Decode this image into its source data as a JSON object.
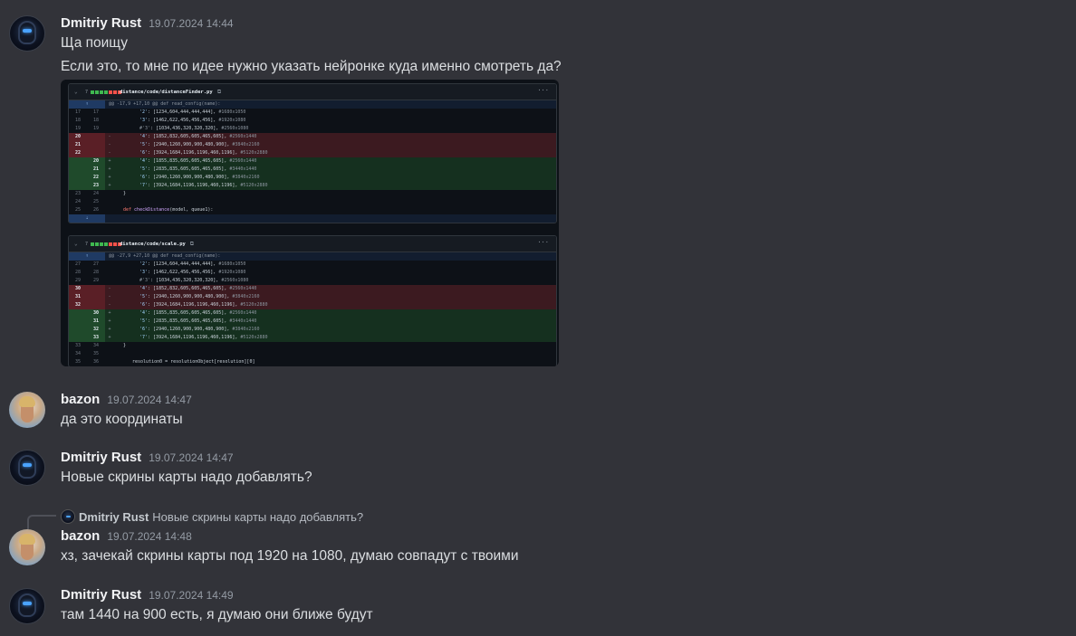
{
  "messages": [
    {
      "author": "Dmitriy Rust",
      "time": "19.07.2024 14:44",
      "lines": [
        "Ща поищу",
        "Если это, то мне по идее нужно указать нейронке куда именно смотреть да?"
      ]
    },
    {
      "author": "bazon",
      "time": "19.07.2024 14:47",
      "lines": [
        "да это координаты"
      ]
    },
    {
      "author": "Dmitriy Rust",
      "time": "19.07.2024 14:47",
      "lines": [
        "Новые скрины карты надо добавлять?"
      ]
    },
    {
      "reply_to": {
        "author": "Dmitriy Rust",
        "text": "Новые скрины карты надо добавлять?"
      },
      "author": "bazon",
      "time": "19.07.2024 14:48",
      "lines": [
        "хз, зачекай скрины карты под 1920 на 1080, думаю совпадут с твоими"
      ]
    },
    {
      "author": "Dmitriy Rust",
      "time": "19.07.2024 14:49",
      "lines": [
        "там 1440 на 900 есть, я думаю они ближе будут"
      ]
    }
  ],
  "code_image": {
    "files": [
      {
        "changes": "7",
        "path": "distance/code/distanceFinder.py",
        "hunk": "@@ -17,9 +17,10 @@ def read_config(name):",
        "rows": [
          {
            "t": "ctx",
            "o": "17",
            "n": "17",
            "s": "",
            "c": "'2': [1234,604,444,444,444], #1680x1050"
          },
          {
            "t": "ctx",
            "o": "18",
            "n": "18",
            "s": "",
            "c": "'3': [1462,622,456,456,456], #1920x1080"
          },
          {
            "t": "ctx",
            "o": "19",
            "n": "19",
            "s": "",
            "c": "#'3': [1034,436,320,320,320], #2560x1080"
          },
          {
            "t": "del",
            "o": "20",
            "n": "",
            "s": "-",
            "c": "'4': [1852,832,605,605,465,605], #2560x1440"
          },
          {
            "t": "del",
            "o": "21",
            "n": "",
            "s": "-",
            "c": "'5': [2940,1260,900,900,480,900], #3840x2160"
          },
          {
            "t": "del",
            "o": "22",
            "n": "",
            "s": "-",
            "c": "'6': [3924,1684,1196,1196,460,1196], #5120x2880"
          },
          {
            "t": "add",
            "o": "",
            "n": "20",
            "s": "+",
            "c": "'4': [1855,835,605,605,465,605], #2560x1440"
          },
          {
            "t": "add",
            "o": "",
            "n": "21",
            "s": "+",
            "c": "'5': [2835,835,605,605,465,605], #3440x1440"
          },
          {
            "t": "add",
            "o": "",
            "n": "22",
            "s": "+",
            "c": "'6': [2940,1260,900,900,480,900], #3840x2160"
          },
          {
            "t": "add",
            "o": "",
            "n": "23",
            "s": "+",
            "c": "'7': [3924,1684,1196,1196,460,1196], #5120x2880"
          },
          {
            "t": "ctx",
            "o": "23",
            "n": "24",
            "s": "",
            "c": "}"
          },
          {
            "t": "ctx",
            "o": "24",
            "n": "25",
            "s": "",
            "c": ""
          },
          {
            "t": "ctx",
            "o": "25",
            "n": "26",
            "s": "",
            "c": "def checkDistance(model, queue1):"
          }
        ]
      },
      {
        "changes": "7",
        "path": "distance/code/scale.py",
        "hunk": "@@ -27,9 +27,10 @@ def read_config(name):",
        "rows": [
          {
            "t": "ctx",
            "o": "27",
            "n": "27",
            "s": "",
            "c": "'2': [1234,604,444,444,444], #1680x1050"
          },
          {
            "t": "ctx",
            "o": "28",
            "n": "28",
            "s": "",
            "c": "'3': [1462,622,456,456,456], #1920x1080"
          },
          {
            "t": "ctx",
            "o": "29",
            "n": "29",
            "s": "",
            "c": "#'3': [1034,436,320,320,320], #2560x1080"
          },
          {
            "t": "del",
            "o": "30",
            "n": "",
            "s": "-",
            "c": "'4': [1852,832,605,605,465,605], #2560x1440"
          },
          {
            "t": "del",
            "o": "31",
            "n": "",
            "s": "-",
            "c": "'5': [2940,1260,900,900,480,900], #3840x2160"
          },
          {
            "t": "del",
            "o": "32",
            "n": "",
            "s": "-",
            "c": "'6': [3924,1684,1196,1196,460,1196], #5120x2880"
          },
          {
            "t": "add",
            "o": "",
            "n": "30",
            "s": "+",
            "c": "'4': [1855,835,605,605,465,605], #2560x1440"
          },
          {
            "t": "add",
            "o": "",
            "n": "31",
            "s": "+",
            "c": "'5': [2835,835,605,605,465,605], #3440x1440"
          },
          {
            "t": "add",
            "o": "",
            "n": "32",
            "s": "+",
            "c": "'6': [2940,1260,900,900,480,900], #3840x2160"
          },
          {
            "t": "add",
            "o": "",
            "n": "33",
            "s": "+",
            "c": "'7': [3924,1684,1196,1196,460,1196], #5120x2880"
          },
          {
            "t": "ctx",
            "o": "33",
            "n": "34",
            "s": "",
            "c": "}"
          },
          {
            "t": "ctx",
            "o": "34",
            "n": "35",
            "s": "",
            "c": ""
          },
          {
            "t": "ctx",
            "o": "35",
            "n": "36",
            "s": "",
            "c": "resolution0 = resolutionObject[resolution][0]"
          }
        ]
      }
    ]
  },
  "colors": {
    "background": "#323339",
    "username": "#f2f3f5",
    "timestamp": "#949ba4",
    "text": "#dbdee1"
  }
}
